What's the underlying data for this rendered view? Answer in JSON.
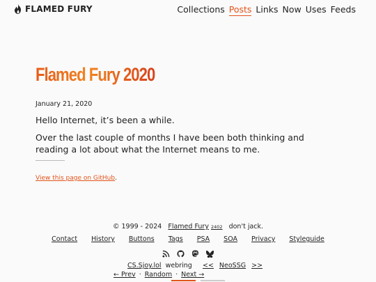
{
  "header": {
    "brand": "FLAMED FURY",
    "nav": [
      {
        "label": "Collections",
        "active": false
      },
      {
        "label": "Posts",
        "active": true
      },
      {
        "label": "Links",
        "active": false
      },
      {
        "label": "Now",
        "active": false
      },
      {
        "label": "Uses",
        "active": false
      },
      {
        "label": "Feeds",
        "active": false
      }
    ],
    "accent_color": "#e2531a"
  },
  "post": {
    "title": "Flamed Fury 2020",
    "date": "January 21, 2020",
    "paragraph1": "Hello Internet, it’s been a while.",
    "paragraph2": "Over the last couple of months I have been both thinking and reading a lot about what the Internet means to me.",
    "github_link": "View this page on GitHub",
    "github_suffix": "."
  },
  "footer": {
    "copyright": "© 1999 - 2024",
    "site_name": "Flamed Fury",
    "version": "2402",
    "tagline": "don't jack.",
    "links": [
      "Contact",
      "History",
      "Buttons",
      "Tags",
      "PSA",
      "SOA",
      "Privacy",
      "Styleguide"
    ],
    "icons": [
      "rss-icon",
      "github-icon",
      "mastodon-icon",
      "bluesky-icon"
    ],
    "webring": {
      "name": "CS.Sjoy.lol",
      "label": "webring",
      "prev": "← Prev",
      "random": "Random",
      "next": "Next →",
      "sep": "·",
      "neo_prev": "<<",
      "neo_name": "NeoSSG",
      "neo_next": ">>"
    }
  }
}
